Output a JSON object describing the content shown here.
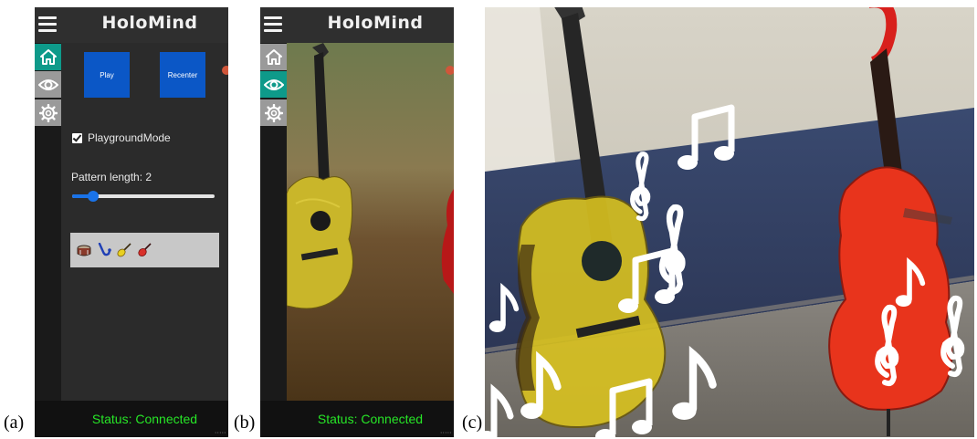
{
  "captions": {
    "a": "(a)",
    "b": "(b)",
    "c": "(c)"
  },
  "panel_a": {
    "title": "HoloMind",
    "nav": [
      {
        "icon": "home-icon",
        "active": true
      },
      {
        "icon": "eye-icon",
        "active": false
      },
      {
        "icon": "gear-icon",
        "active": false
      }
    ],
    "buttons": {
      "play": "Play",
      "recenter": "Recenter"
    },
    "playground_mode": {
      "label": "PlaygroundMode",
      "checked": true
    },
    "pattern_length": {
      "label": "Pattern length: 2",
      "value": 2,
      "fraction": 0.15
    },
    "instruments": [
      "drum-icon",
      "saxophone-icon",
      "guitar-icon",
      "violin-icon"
    ],
    "status": "Status: Connected"
  },
  "panel_b": {
    "title": "HoloMind",
    "nav": [
      {
        "icon": "home-icon",
        "active": false
      },
      {
        "icon": "eye-icon",
        "active": true
      },
      {
        "icon": "gear-icon",
        "active": false
      }
    ],
    "status": "Status: Connected"
  },
  "colors": {
    "accent_teal": "#0e9a8a",
    "button_blue": "#0b57c6",
    "status_green": "#27e627",
    "guitar_yellow": "#d9c21f",
    "bass_red": "#e8341c"
  }
}
